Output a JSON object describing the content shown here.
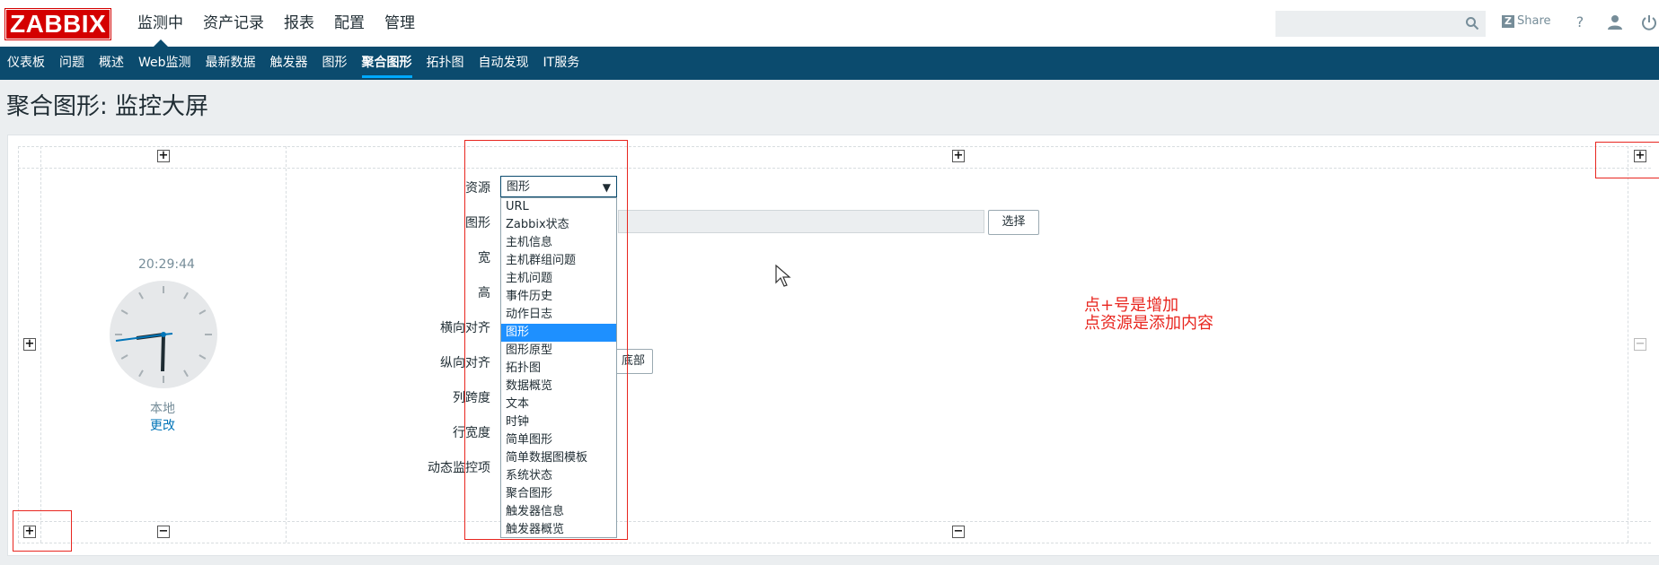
{
  "logo": "ZABBIX",
  "main_nav": [
    "监测中",
    "资产记录",
    "报表",
    "配置",
    "管理"
  ],
  "main_nav_active": 0,
  "share_label": "Share",
  "help_label": "?",
  "sub_nav": [
    "仪表板",
    "问题",
    "概述",
    "Web监测",
    "最新数据",
    "触发器",
    "图形",
    "聚合图形",
    "拓扑图",
    "自动发现",
    "IT服务"
  ],
  "sub_nav_active": 7,
  "page_title": "聚合图形: 监控大屏",
  "clock": {
    "time": "20:29:44",
    "zone_label": "本地",
    "change_link": "更改"
  },
  "form": {
    "labels": [
      "资源",
      "图形",
      "宽",
      "高",
      "横向对齐",
      "纵向对齐",
      "列跨度",
      "行宽度",
      "动态监控项"
    ],
    "resource_selected": "图形",
    "select_button": "选择",
    "partial_button": "底部"
  },
  "dropdown_options": [
    "URL",
    "Zabbix状态",
    "主机信息",
    "主机群组问题",
    "主机问题",
    "事件历史",
    "动作日志",
    "图形",
    "图形原型",
    "拓扑图",
    "数据概览",
    "文本",
    "时钟",
    "简单图形",
    "简单数据图模板",
    "系统状态",
    "聚合图形",
    "触发器信息",
    "触发器概览"
  ],
  "dropdown_selected_index": 7,
  "annotation": [
    "点+号是增加",
    "点资源是添加内容"
  ],
  "colors": {
    "brand": "#d40000",
    "nav": "#0b4b6e",
    "accent": "#00aaff",
    "annotation": "#e8261f",
    "selected": "#1e90ff"
  }
}
